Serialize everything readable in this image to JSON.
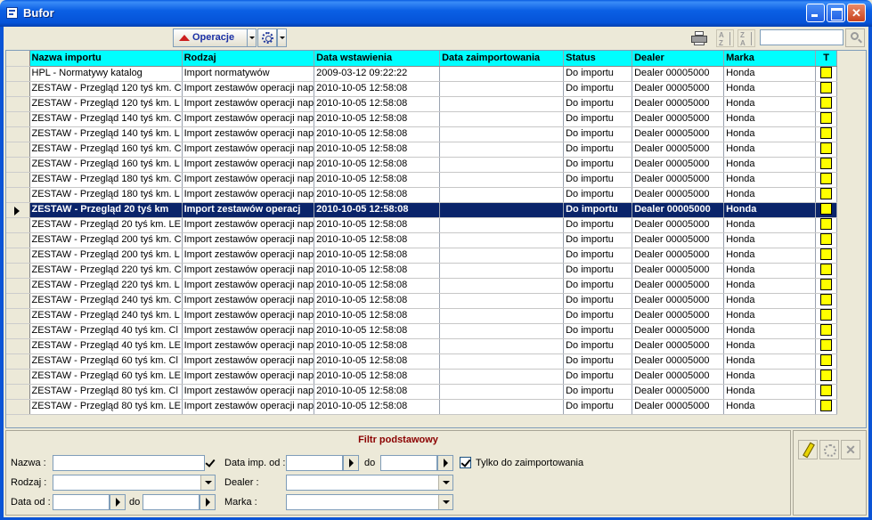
{
  "window": {
    "title": "Bufor"
  },
  "toolbar": {
    "operations_label": "Operacje"
  },
  "grid": {
    "columns": [
      "Nazwa importu",
      "Rodzaj",
      "Data wstawienia",
      "Data zaimportowania",
      "Status",
      "Dealer",
      "Marka",
      "T"
    ],
    "rows": [
      [
        "HPL - Normatywy katalog",
        "Import normatywów",
        "2009-03-12 09:22:22",
        "",
        "Do importu",
        "Dealer 00005000",
        "Honda"
      ],
      [
        "ZESTAW - Przegląd 120 tyś km.  C",
        "Import zestawów operacji nap",
        "2010-10-05 12:58:08",
        "",
        "Do importu",
        "Dealer 00005000",
        "Honda"
      ],
      [
        "ZESTAW - Przegląd 120 tyś km.  L",
        "Import zestawów operacji nap",
        "2010-10-05 12:58:08",
        "",
        "Do importu",
        "Dealer 00005000",
        "Honda"
      ],
      [
        "ZESTAW - Przegląd 140 tyś km.  C",
        "Import zestawów operacji nap",
        "2010-10-05 12:58:08",
        "",
        "Do importu",
        "Dealer 00005000",
        "Honda"
      ],
      [
        "ZESTAW - Przegląd 140 tyś km.  L",
        "Import zestawów operacji nap",
        "2010-10-05 12:58:08",
        "",
        "Do importu",
        "Dealer 00005000",
        "Honda"
      ],
      [
        "ZESTAW - Przegląd 160 tyś km.  C",
        "Import zestawów operacji nap",
        "2010-10-05 12:58:08",
        "",
        "Do importu",
        "Dealer 00005000",
        "Honda"
      ],
      [
        "ZESTAW - Przegląd 160 tyś km.  L",
        "Import zestawów operacji nap",
        "2010-10-05 12:58:08",
        "",
        "Do importu",
        "Dealer 00005000",
        "Honda"
      ],
      [
        "ZESTAW - Przegląd 180 tyś km.  C",
        "Import zestawów operacji nap",
        "2010-10-05 12:58:08",
        "",
        "Do importu",
        "Dealer 00005000",
        "Honda"
      ],
      [
        "ZESTAW - Przegląd 180 tyś km.  L",
        "Import zestawów operacji nap",
        "2010-10-05 12:58:08",
        "",
        "Do importu",
        "Dealer 00005000",
        "Honda"
      ],
      [
        "ZESTAW - Przegląd 20 tyś km",
        "Import zestawów operacj",
        "2010-10-05 12:58:08",
        "",
        "Do importu",
        "Dealer 00005000",
        "Honda"
      ],
      [
        "ZESTAW - Przegląd 20 tyś km.  LE",
        "Import zestawów operacji nap",
        "2010-10-05 12:58:08",
        "",
        "Do importu",
        "Dealer 00005000",
        "Honda"
      ],
      [
        "ZESTAW - Przegląd 200 tyś km.  C",
        "Import zestawów operacji nap",
        "2010-10-05 12:58:08",
        "",
        "Do importu",
        "Dealer 00005000",
        "Honda"
      ],
      [
        "ZESTAW - Przegląd 200 tyś km.  L",
        "Import zestawów operacji nap",
        "2010-10-05 12:58:08",
        "",
        "Do importu",
        "Dealer 00005000",
        "Honda"
      ],
      [
        "ZESTAW - Przegląd 220 tyś km.  C",
        "Import zestawów operacji nap",
        "2010-10-05 12:58:08",
        "",
        "Do importu",
        "Dealer 00005000",
        "Honda"
      ],
      [
        "ZESTAW - Przegląd 220 tyś km.  L",
        "Import zestawów operacji nap",
        "2010-10-05 12:58:08",
        "",
        "Do importu",
        "Dealer 00005000",
        "Honda"
      ],
      [
        "ZESTAW - Przegląd 240 tyś km.  C",
        "Import zestawów operacji nap",
        "2010-10-05 12:58:08",
        "",
        "Do importu",
        "Dealer 00005000",
        "Honda"
      ],
      [
        "ZESTAW - Przegląd 240 tyś km.  L",
        "Import zestawów operacji nap",
        "2010-10-05 12:58:08",
        "",
        "Do importu",
        "Dealer 00005000",
        "Honda"
      ],
      [
        "ZESTAW - Przegląd 40 tyś km.  Cl",
        "Import zestawów operacji nap",
        "2010-10-05 12:58:08",
        "",
        "Do importu",
        "Dealer 00005000",
        "Honda"
      ],
      [
        "ZESTAW - Przegląd 40 tyś km.  LE",
        "Import zestawów operacji nap",
        "2010-10-05 12:58:08",
        "",
        "Do importu",
        "Dealer 00005000",
        "Honda"
      ],
      [
        "ZESTAW - Przegląd 60 tyś km.  Cl",
        "Import zestawów operacji nap",
        "2010-10-05 12:58:08",
        "",
        "Do importu",
        "Dealer 00005000",
        "Honda"
      ],
      [
        "ZESTAW - Przegląd 60 tyś km.  LE",
        "Import zestawów operacji nap",
        "2010-10-05 12:58:08",
        "",
        "Do importu",
        "Dealer 00005000",
        "Honda"
      ],
      [
        "ZESTAW - Przegląd 80 tyś km.  Cl",
        "Import zestawów operacji nap",
        "2010-10-05 12:58:08",
        "",
        "Do importu",
        "Dealer 00005000",
        "Honda"
      ],
      [
        "ZESTAW - Przegląd 80 tyś km.  LE",
        "Import zestawów operacji nap",
        "2010-10-05 12:58:08",
        "",
        "Do importu",
        "Dealer 00005000",
        "Honda"
      ]
    ],
    "selected_row": 9,
    "flag_color": "#ffff00",
    "header_color": "#00fefe",
    "selection_color": "#0a246a"
  },
  "filter": {
    "title": "Filtr podstawowy",
    "name_label": "Nazwa :",
    "type_label": "Rodzaj :",
    "date_from_label": "Data od :",
    "date_to_label": "do",
    "imp_date_label": "Data imp. od :",
    "imp_date_to_label": "do",
    "dealer_label": "Dealer :",
    "brand_label": "Marka :",
    "only_to_import_label": "Tylko do zaimportowania"
  }
}
